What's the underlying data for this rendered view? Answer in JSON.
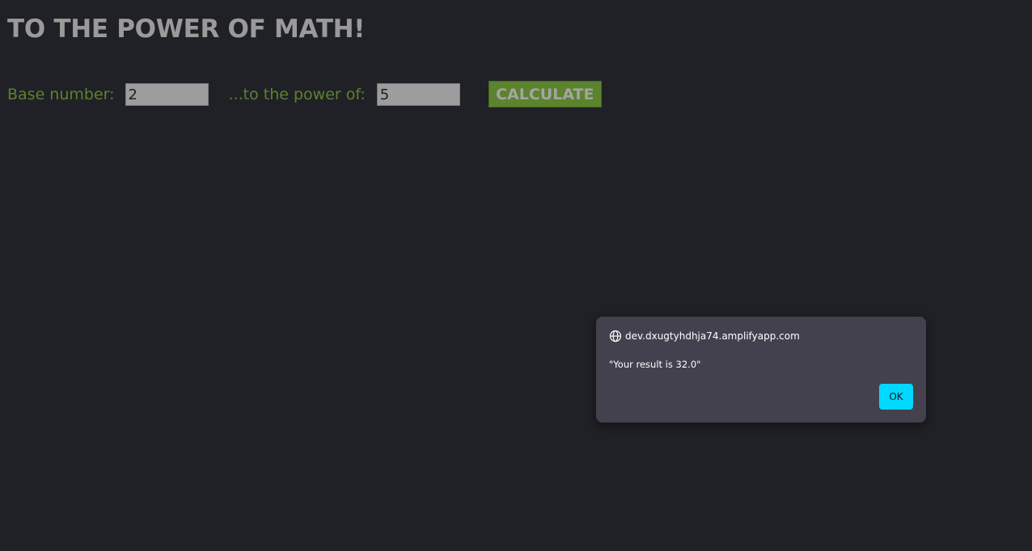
{
  "page": {
    "title": "TO THE POWER OF MATH!"
  },
  "form": {
    "base_label": "Base number:",
    "base_value": "2",
    "power_label": "...to the power of:",
    "power_value": "5",
    "calculate_label": "CALCULATE"
  },
  "dialog": {
    "origin": "dev.dxugtyhdhja74.amplifyapp.com",
    "origin_icon": "globe-icon",
    "message": "\"Your result is 32.0\"",
    "ok_label": "OK"
  },
  "colors": {
    "background": "#202126",
    "title": "#9a9a9a",
    "label_green": "#5c832d",
    "button_green": "#5c832d",
    "input_gray": "#9d9d9d",
    "dialog_bg": "#43414e",
    "ok_accent": "#00d8ff"
  }
}
